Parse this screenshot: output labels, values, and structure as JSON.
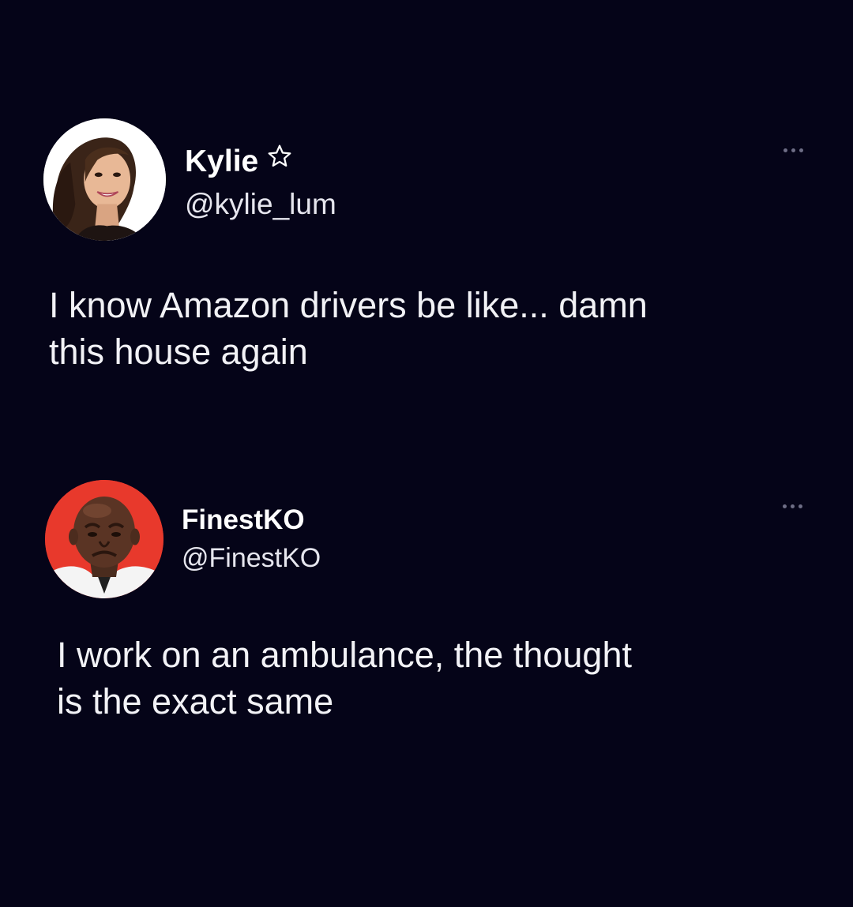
{
  "theme": {
    "background": "#050418",
    "text": "#f2f2f6"
  },
  "tweets": [
    {
      "display_name": "Kylie",
      "badge_icon": "star-outline-icon",
      "handle": "@kylie_lum",
      "text": "I know Amazon drivers be like... damn\nthis house again",
      "avatar_icon": "profile-photo-woman",
      "menu_icon": "more-options-icon"
    },
    {
      "display_name": "FinestKO",
      "handle": "@FinestKO",
      "text": "I work on an ambulance, the thought\nis the exact same",
      "avatar_icon": "profile-photo-crying-man",
      "avatar_ring_color": "#e8392c",
      "menu_icon": "more-options-icon"
    }
  ]
}
